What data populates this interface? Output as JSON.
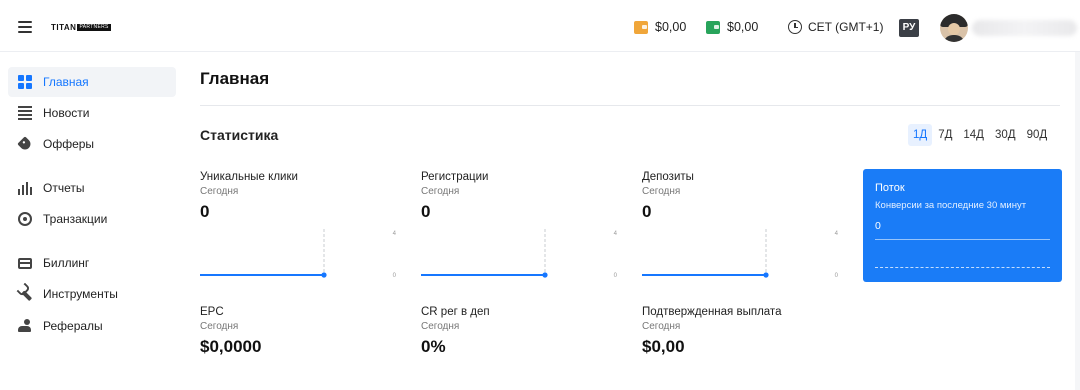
{
  "header": {
    "logo_main": "TITAN",
    "logo_sub": "PARTNERS",
    "wallets": [
      {
        "amount": "$0,00",
        "icon": "orange-wallet-icon",
        "color": "#f0a63a"
      },
      {
        "amount": "$0,00",
        "icon": "green-wallet-icon",
        "color": "#28a45b"
      }
    ],
    "timezone": "CET (GMT+1)",
    "language": "РУ"
  },
  "sidebar": {
    "items": [
      {
        "label": "Главная",
        "icon": "dashboard-icon",
        "active": true
      },
      {
        "label": "Новости",
        "icon": "news-icon"
      },
      {
        "label": "Офферы",
        "icon": "tag-icon"
      },
      {
        "label": "Отчеты",
        "icon": "bar-chart-icon"
      },
      {
        "label": "Транзакции",
        "icon": "transactions-icon"
      },
      {
        "label": "Биллинг",
        "icon": "credit-card-icon"
      },
      {
        "label": "Инструменты",
        "icon": "wrench-icon"
      },
      {
        "label": "Рефералы",
        "icon": "referrals-icon"
      }
    ]
  },
  "main": {
    "title": "Главная",
    "section_title": "Статистика",
    "periods": [
      "1Д",
      "7Д",
      "14Д",
      "30Д",
      "90Д"
    ],
    "active_period": "1Д",
    "stats": [
      {
        "label": "Уникальные клики",
        "sub": "Сегодня",
        "value": "0",
        "chart": {
          "ymax": "4",
          "ymin": "0",
          "value": 0
        }
      },
      {
        "label": "Регистрации",
        "sub": "Сегодня",
        "value": "0",
        "chart": {
          "ymax": "4",
          "ymin": "0",
          "value": 0
        }
      },
      {
        "label": "Депозиты",
        "sub": "Сегодня",
        "value": "0",
        "chart": {
          "ymax": "4",
          "ymin": "0",
          "value": 0
        }
      },
      {
        "label": "EPC",
        "sub": "Сегодня",
        "value": "$0,0000"
      },
      {
        "label": "CR рег в деп",
        "sub": "Сегодня",
        "value": "0%"
      },
      {
        "label": "Подтвержденная выплата",
        "sub": "Сегодня",
        "value": "$0,00"
      }
    ],
    "flow": {
      "title": "Поток",
      "subtitle": "Конверсии за последние 30 минут",
      "value": "0"
    }
  },
  "colors": {
    "accent": "#1677ff",
    "flow_bg": "#1a7cf7"
  }
}
